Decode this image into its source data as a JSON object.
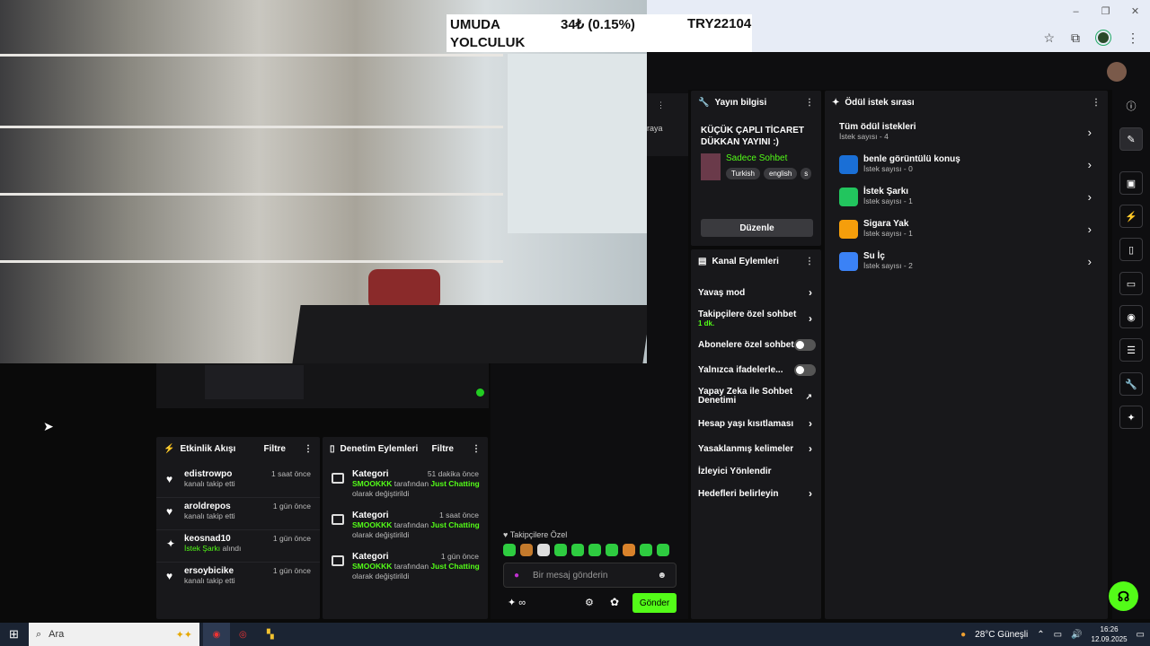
{
  "ticker": {
    "name": "UMUDA YOLCULUK",
    "change": "34₺ (0.15%)",
    "value": "TRY22104"
  },
  "chat_header_fragment": "raya",
  "stream_info": {
    "header": "Yayın bilgisi",
    "title": "KÜÇÜK ÇAPLI TİCARET DÜKKAN YAYINI :)",
    "category": "Sadece Sohbet",
    "tags": [
      "Turkish",
      "english",
      "s"
    ],
    "edit_button": "Düzenle"
  },
  "channel_actions": {
    "header": "Kanal Eylemleri",
    "items": [
      {
        "label": "Yavaş mod",
        "sub": "",
        "control": "chevron"
      },
      {
        "label": "Takipçilere özel sohbet",
        "sub": "1 dk.",
        "control": "chevron"
      },
      {
        "label": "Abonelere özel sohbet",
        "sub": "",
        "control": "toggle"
      },
      {
        "label": "Yalnızca ifadelerle...",
        "sub": "",
        "control": "toggle"
      },
      {
        "label": "Yapay Zeka ile Sohbet Denetimi",
        "sub": "",
        "control": "external"
      },
      {
        "label": "Hesap yaşı kısıtlaması",
        "sub": "",
        "control": "chevron"
      },
      {
        "label": "Yasaklanmış kelimeler",
        "sub": "",
        "control": "chevron"
      },
      {
        "label": "İzleyici Yönlendir",
        "sub": "",
        "control": "none"
      },
      {
        "label": "Hedefleri belirleyin",
        "sub": "",
        "control": "chevron"
      }
    ]
  },
  "rewards": {
    "header": "Ödül istek sırası",
    "all": {
      "title": "Tüm ödül istekleri",
      "sub": "İstek sayısı - 4"
    },
    "items": [
      {
        "title": "benle görüntülü konuş",
        "sub": "İstek sayısı - 0",
        "color": "#1a6fd6"
      },
      {
        "title": "İstek Şarkı",
        "sub": "İstek sayısı - 1",
        "color": "#22c55e"
      },
      {
        "title": "Sigara Yak",
        "sub": "İstek sayısı - 1",
        "color": "#f59e0b"
      },
      {
        "title": "Su İç",
        "sub": "İstek sayısı - 2",
        "color": "#3b82f6"
      }
    ]
  },
  "activity": {
    "header": "Etkinlik Akışı",
    "filter": "Filtre",
    "items": [
      {
        "user": "edistrowpo",
        "action": "kanalı takip etti",
        "time": "1 saat önce",
        "icon": "heart"
      },
      {
        "user": "aroldrepos",
        "action": "kanalı takip etti",
        "time": "1 gün önce",
        "icon": "heart"
      },
      {
        "user": "keosnad10",
        "action_green": "İstek Şarkı",
        "action": "alındı",
        "time": "1 gün önce",
        "icon": "reward"
      },
      {
        "user": "ersoybicike",
        "action": "kanalı takip etti",
        "time": "1 gün önce",
        "icon": "heart"
      }
    ]
  },
  "moderation": {
    "header": "Denetim Eylemleri",
    "filter": "Filtre",
    "items": [
      {
        "title": "Kategori",
        "time": "51 dakika önce",
        "who": "SMOOKKK",
        "by": "tarafından",
        "what": "Just Chatting",
        "tail": "olarak değiştirildi"
      },
      {
        "title": "Kategori",
        "time": "1 saat önce",
        "who": "SMOOKKK",
        "by": "tarafından",
        "what": "Just Chatting",
        "tail": "olarak değiştirildi"
      },
      {
        "title": "Kategori",
        "time": "1 gün önce",
        "who": "SMOOKKK",
        "by": "tarafından",
        "what": "Just Chatting",
        "tail": "olarak değiştirildi"
      }
    ]
  },
  "chat": {
    "followers_only": "Takipçilere Özel",
    "placeholder": "Bir mesaj gönderin",
    "points": "∞",
    "send": "Gönder"
  },
  "taskbar": {
    "search": "Ara",
    "weather": "28°C Güneşli",
    "time": "16:26",
    "date": "12.09.2025"
  },
  "colors": {
    "accent": "#53fc18",
    "panel": "#18181b",
    "bg": "#0e0e10"
  }
}
